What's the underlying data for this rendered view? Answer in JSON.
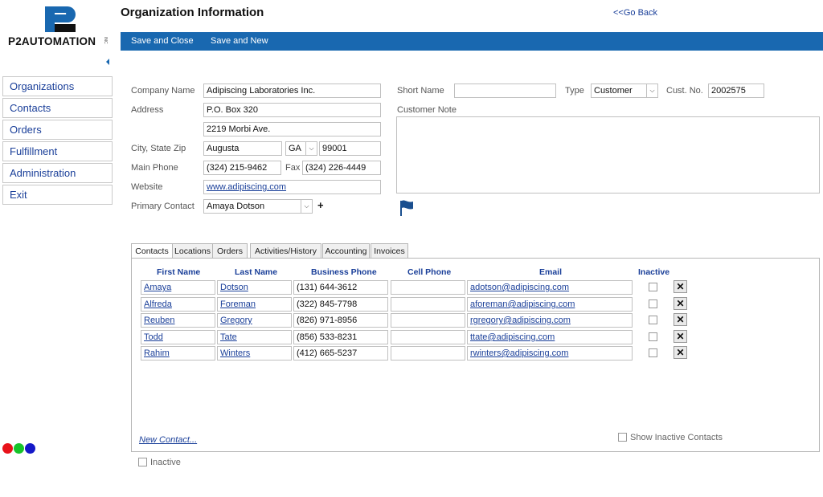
{
  "logo": {
    "text_p2": "P2",
    "text_rest": "AUTOMATION",
    "tm": "INC"
  },
  "page_title": "Organization Information",
  "go_back": "<<Go Back",
  "toolbar": {
    "save_close": "Save and Close",
    "save_new": "Save and New"
  },
  "sidebar": {
    "items": [
      {
        "label": "Organizations"
      },
      {
        "label": "Contacts"
      },
      {
        "label": "Orders"
      },
      {
        "label": "Fulfillment"
      },
      {
        "label": "Administration"
      },
      {
        "label": "Exit"
      }
    ]
  },
  "form": {
    "company_name_label": "Company Name",
    "company_name": "Adipiscing Laboratories Inc.",
    "address_label": "Address",
    "address1": "P.O. Box 320",
    "address2": "2219 Morbi Ave.",
    "city_state_zip_label": "City, State Zip",
    "city": "Augusta",
    "state": "GA",
    "zip": "99001",
    "main_phone_label": "Main Phone",
    "main_phone": "(324) 215-9462",
    "fax_label": "Fax",
    "fax": "(324) 226-4449",
    "website_label": "Website",
    "website": "www.adipiscing.com",
    "primary_contact_label": "Primary Contact",
    "primary_contact": "Amaya Dotson",
    "plus": "+",
    "short_name_label": "Short Name",
    "short_name": "",
    "type_label": "Type",
    "type": "Customer",
    "cust_no_label": "Cust. No.",
    "cust_no": "2002575",
    "customer_note_label": "Customer Note",
    "customer_note": ""
  },
  "tabs": [
    {
      "label": "Contacts",
      "active": true
    },
    {
      "label": "Locations"
    },
    {
      "label": "Orders"
    },
    {
      "label": "Activities/History"
    },
    {
      "label": "Accounting"
    },
    {
      "label": "Invoices"
    }
  ],
  "contacts_table": {
    "headers": [
      "First Name",
      "Last Name",
      "Business Phone",
      "Cell Phone",
      "Email",
      "Inactive"
    ],
    "rows": [
      {
        "first": "Amaya",
        "last": "Dotson",
        "business": "(131) 644-3612",
        "cell": "",
        "email": "adotson@adipiscing.com",
        "inactive": false
      },
      {
        "first": "Alfreda",
        "last": "Foreman",
        "business": "(322) 845-7798",
        "cell": "",
        "email": "aforeman@adipiscing.com",
        "inactive": false
      },
      {
        "first": "Reuben",
        "last": "Gregory",
        "business": "(826) 971-8956",
        "cell": "",
        "email": "rgregory@adipiscing.com",
        "inactive": false
      },
      {
        "first": "Todd",
        "last": "Tate",
        "business": "(856) 533-8231",
        "cell": "",
        "email": "ttate@adipiscing.com",
        "inactive": false
      },
      {
        "first": "Rahim",
        "last": "Winters",
        "business": "(412) 665-5237",
        "cell": "",
        "email": "rwinters@adipiscing.com",
        "inactive": false
      }
    ],
    "delete_glyph": "✕",
    "new_contact": "New Contact...",
    "show_inactive": "Show Inactive Contacts"
  },
  "inactive_label": "Inactive",
  "icons": {
    "flag": "flag-icon",
    "collapse": "chevron-left-icon",
    "delete": "close-icon"
  },
  "colors": {
    "brand_blue": "#1968b0",
    "link": "#1a3f99",
    "dot_red": "#e8121a",
    "dot_green": "#17c42a",
    "dot_blue": "#1418c8"
  }
}
